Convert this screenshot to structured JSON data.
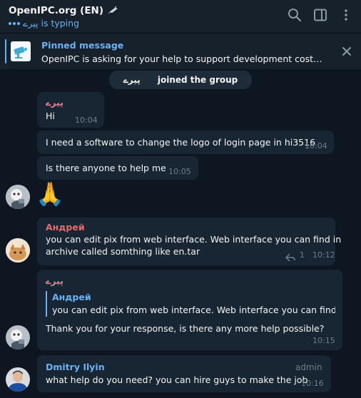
{
  "header": {
    "title": "OpenIPC.org (EN)",
    "status_user": "پیرے",
    "status_text": "is typing"
  },
  "pinned": {
    "label": "Pinned message",
    "text": "OpenIPC is asking for your help to support development cost an..."
  },
  "service": {
    "name": "پیرے",
    "text": "joined the group"
  },
  "messages": [
    {
      "sender": "پیرے",
      "text": "Hi",
      "time": "10:04"
    },
    {
      "text": "I need a software to change the logo of login page in hi3516",
      "time": "10:04"
    },
    {
      "text": "Is there anyone to help me",
      "time": "10:05"
    },
    {
      "emoji": "🙏"
    },
    {
      "sender": "Андрей",
      "text1": "you can edit pix from web interface. Web interface you can find in",
      "text2": "archive called somthing like en.tar",
      "replies": "1",
      "time": "10:12"
    },
    {
      "sender": "پیرے",
      "reply_sender": "Андрей",
      "reply_text": "you can edit pix from web interface. Web interface you can find i...",
      "text": "Thank you for your response, is there any more help possible?",
      "time": "10:15"
    },
    {
      "sender": "Dmitry Ilyin",
      "role": "admin",
      "text": "what help do you need? you can hire guys to make the job",
      "time": "10:16"
    }
  ],
  "colors": {
    "background": "#0e1621",
    "header": "#17212b",
    "bubble": "#182533",
    "accent": "#6ab2f2",
    "name_pink": "#e27f95",
    "name_red": "#e4696e"
  },
  "icons": [
    "satellite-icon",
    "search-icon",
    "sidebar-toggle-icon",
    "more-vert-icon",
    "camera-logo-icon",
    "close-icon",
    "reply-arrow-icon"
  ]
}
